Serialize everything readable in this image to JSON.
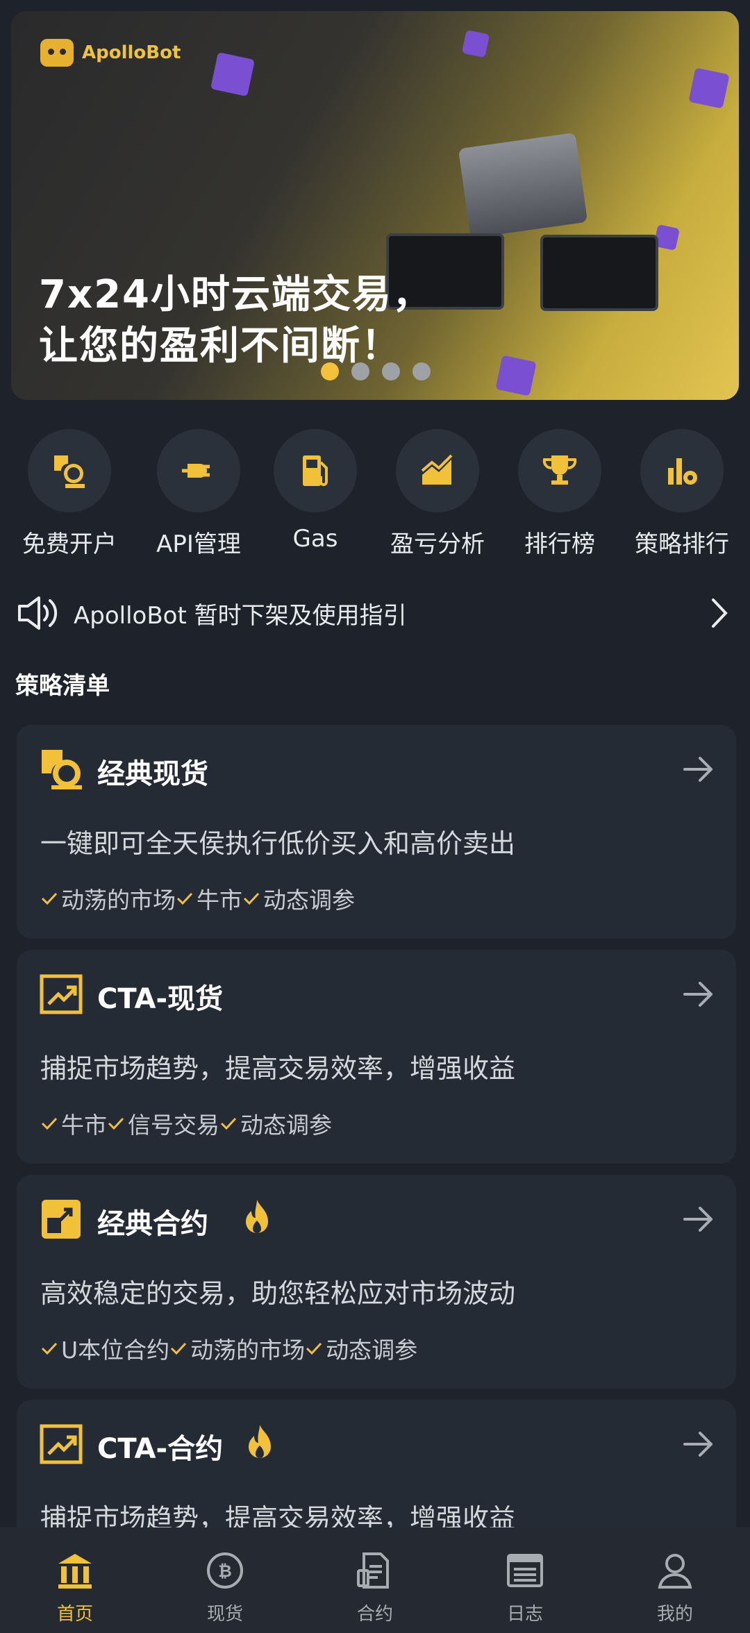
{
  "banner": {
    "brand": "ApolloBot",
    "headline_line1": "7x24小时云端交易，",
    "headline_line2": "让您的盈利不间断！",
    "slide_count": 4,
    "active_slide": 1
  },
  "quick_entries": [
    {
      "label": "免费开户",
      "icon": "exchange-coin-icon"
    },
    {
      "label": "API管理",
      "icon": "plug-icon"
    },
    {
      "label": "Gas",
      "icon": "fuel-pump-icon"
    },
    {
      "label": "盈亏分析",
      "icon": "trend-chart-icon"
    },
    {
      "label": "排行榜",
      "icon": "trophy-icon"
    },
    {
      "label": "策略排行",
      "icon": "bar-chart-gear-icon"
    }
  ],
  "notice": {
    "text": "ApolloBot 暂时下架及使用指引",
    "icon": "speaker-icon"
  },
  "section_title": "策略清单",
  "strategies": [
    {
      "title": "经典现货",
      "icon": "spot-coin-icon",
      "hot": false,
      "desc": "一键即可全天侯执行低价买入和高价卖出",
      "tags": [
        "动荡的市场",
        "牛市",
        "动态调参"
      ]
    },
    {
      "title": "CTA-现货",
      "icon": "trend-up-icon",
      "hot": false,
      "desc": "捕捉市场趋势，提高交易效率，增强收益",
      "tags": [
        "牛市",
        "信号交易",
        "动态调参"
      ]
    },
    {
      "title": "经典合约",
      "icon": "contract-icon",
      "hot": true,
      "desc": "高效稳定的交易，助您轻松应对市场波动",
      "tags": [
        "U本位合约",
        "动荡的市场",
        "动态调参"
      ]
    },
    {
      "title": "CTA-合约",
      "icon": "trend-up-icon",
      "hot": true,
      "desc": "捕捉市场趋势，提高交易效率，增强收益",
      "tags": []
    }
  ],
  "tabbar": [
    {
      "label": "首页",
      "icon": "home-icon",
      "active": true
    },
    {
      "label": "现货",
      "icon": "coin-icon",
      "active": false
    },
    {
      "label": "合约",
      "icon": "contract-doc-icon",
      "active": false
    },
    {
      "label": "日志",
      "icon": "log-icon",
      "active": false
    },
    {
      "label": "我的",
      "icon": "user-icon",
      "active": false
    }
  ],
  "colors": {
    "accent": "#f2c13a",
    "background": "#1e232b",
    "card": "#252b35"
  }
}
